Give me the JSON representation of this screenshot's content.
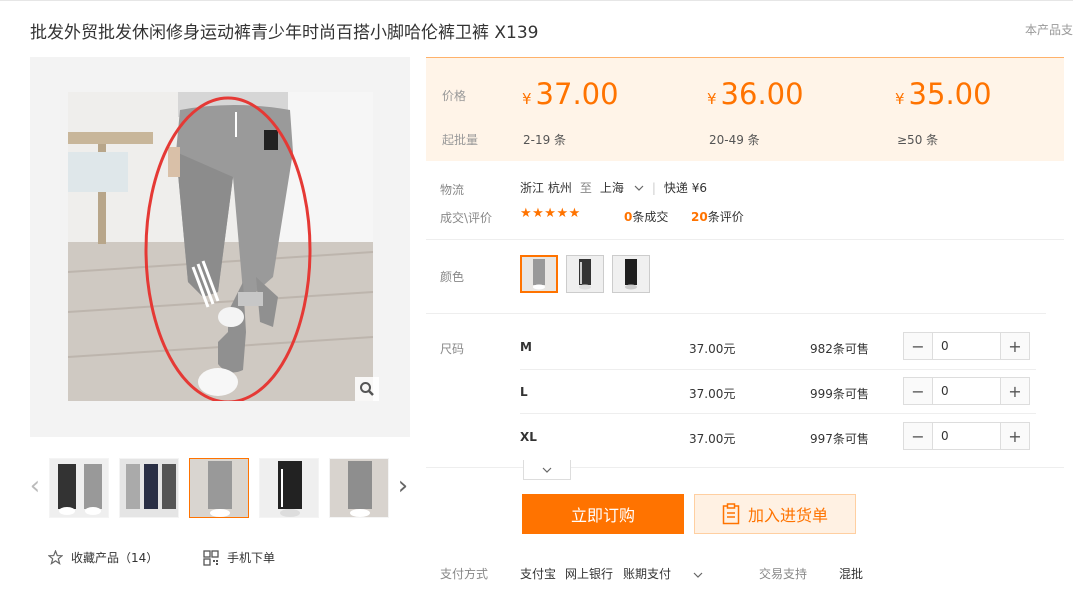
{
  "product": {
    "title": "批发外贸批发休闲修身运动裤青少年时尚百搭小脚哈伦裤卫裤 X139",
    "support_link": "本产品支"
  },
  "gallery": {
    "main_image": "grey-jogger-pants-photo",
    "zoom_icon": "search-icon",
    "thumbnails": [
      {
        "name": "thumb-1",
        "active": false
      },
      {
        "name": "thumb-2",
        "active": false
      },
      {
        "name": "thumb-3",
        "active": true
      },
      {
        "name": "thumb-4",
        "active": false
      },
      {
        "name": "thumb-5",
        "active": false
      }
    ]
  },
  "actions": {
    "favorite_label": "收藏产品（14）",
    "mobile_label": "手机下单"
  },
  "pricing": {
    "price_label": "价格",
    "batch_label": "起批量",
    "currency": "¥",
    "tiers": [
      {
        "price": "37.00",
        "range": "2-19 条"
      },
      {
        "price": "36.00",
        "range": "20-49 条"
      },
      {
        "price": "35.00",
        "range": "≥50 条"
      }
    ]
  },
  "logistics": {
    "label": "物流",
    "from": "浙江 杭州",
    "to_word": "至",
    "to": "上海",
    "shipping": "快递 ¥6"
  },
  "reviews": {
    "label": "成交\\评价",
    "stars": "★★★★★",
    "deal_count": "0",
    "deal_suffix": "条成交",
    "review_count": "20",
    "review_suffix": "条评价"
  },
  "color": {
    "label": "颜色",
    "swatches": [
      "grey",
      "black-white-stripe",
      "black"
    ]
  },
  "sizes": {
    "label": "尺码",
    "rows": [
      {
        "name": "M",
        "price": "37.00元",
        "stock": "982条可售",
        "qty": "0"
      },
      {
        "name": "L",
        "price": "37.00元",
        "stock": "999条可售",
        "qty": "0"
      },
      {
        "name": "XL",
        "price": "37.00元",
        "stock": "997条可售",
        "qty": "0"
      }
    ]
  },
  "buttons": {
    "buy_now": "立即订购",
    "add_to_cart": "加入进货单"
  },
  "payment": {
    "label": "支付方式",
    "methods": [
      "支付宝",
      "网上银行",
      "账期支付"
    ],
    "trade_label": "交易支持",
    "trade_value": "混批"
  },
  "colors": {
    "accent": "#ff7300",
    "price_bg": "#fff4e8"
  }
}
